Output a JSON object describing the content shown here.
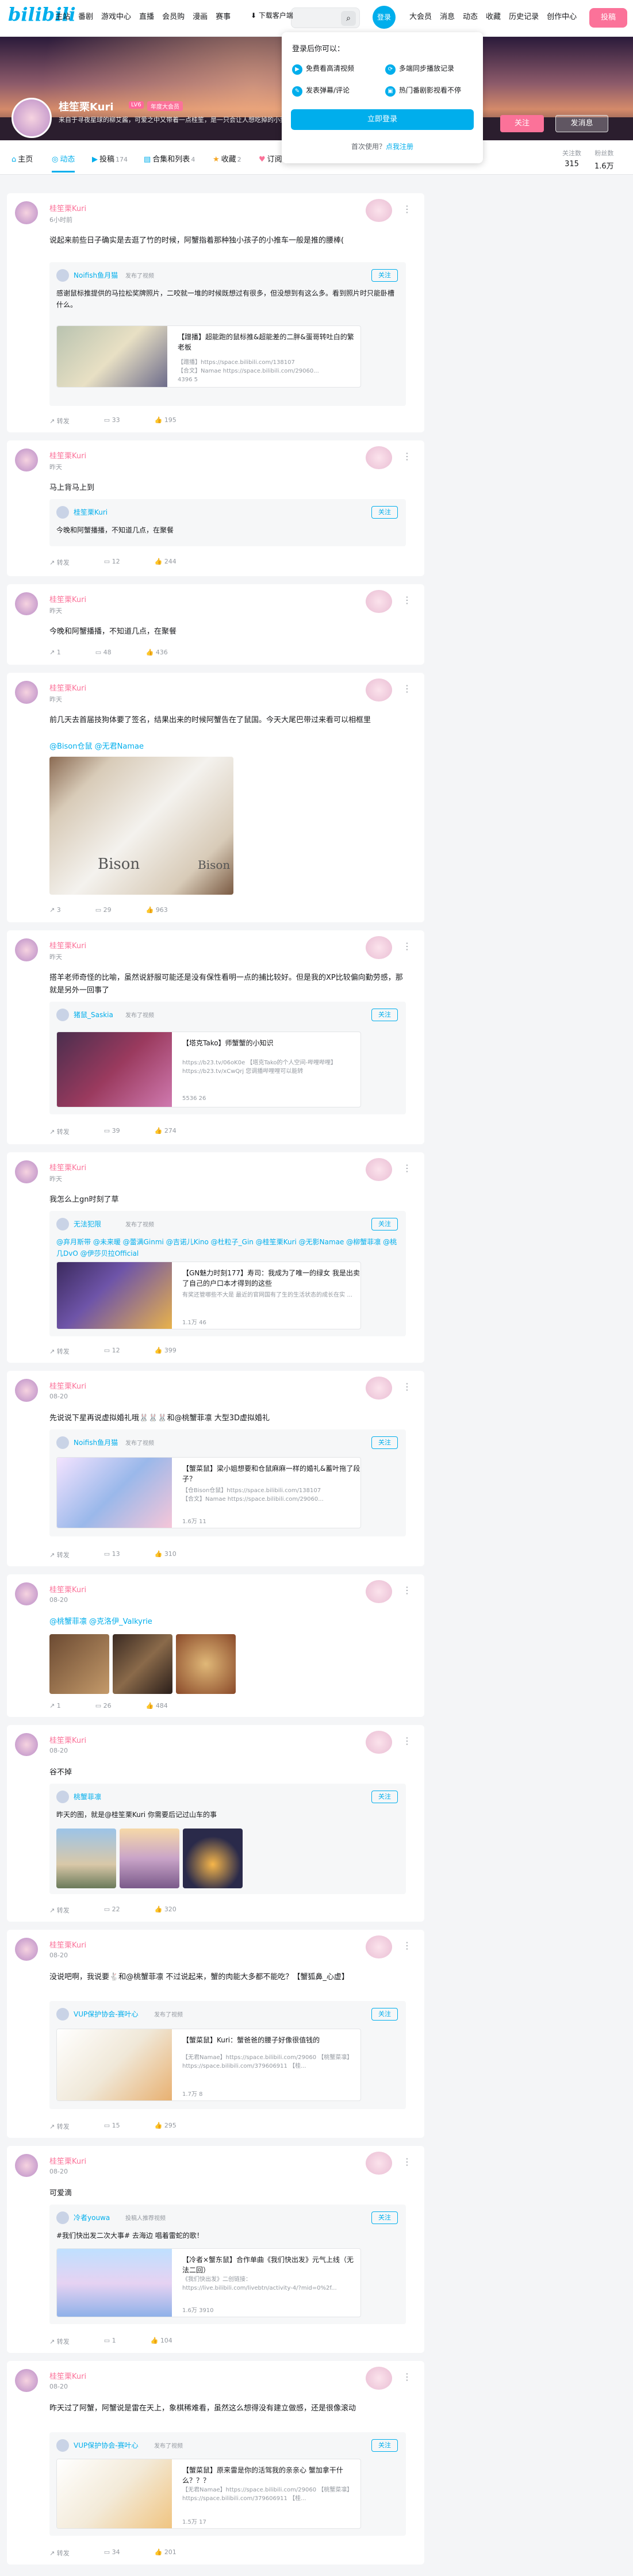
{
  "top": {
    "logo": "bilibili",
    "nav": [
      "主站",
      "番剧",
      "游戏中心",
      "直播",
      "会员购",
      "漫画",
      "赛事"
    ],
    "download": "下载客户端",
    "login_avatar": "登录",
    "nav_right": [
      "大会员",
      "消息",
      "动态",
      "收藏",
      "历史记录",
      "创作中心"
    ],
    "post": "投稿"
  },
  "popup": {
    "title": "登录后你可以：",
    "features": [
      "免费看高清视频",
      "多端同步播放记录",
      "发表弹幕/评论",
      "热门番剧影视看不停"
    ],
    "login": "立即登录",
    "first": "首次使用？",
    "register": "点我注册"
  },
  "user": {
    "name": "桂笙栗Kuri",
    "level": "LV6",
    "vip": "年度大会员",
    "sign": "来自于寻夜星球的柳艾酱，可爱之中又带着一点桂笙，是一只会让人想吃掉的小栗子~",
    "follow": "关注",
    "message": "发消息"
  },
  "tabs": [
    {
      "label": "主页",
      "count": ""
    },
    {
      "label": "动态",
      "count": ""
    },
    {
      "label": "投稿",
      "count": "174"
    },
    {
      "label": "合集和列表",
      "count": "4"
    },
    {
      "label": "收藏",
      "count": "2"
    },
    {
      "label": "订阅",
      "count": ""
    }
  ],
  "stats": [
    {
      "label": "关注数",
      "value": "315"
    },
    {
      "label": "粉丝数",
      "value": "1.6万"
    }
  ],
  "feed": [
    {
      "name": "桂笙栗Kuri",
      "time": "6小时前",
      "text": "说起来前些日子确实是去逛了竹的时候，阿蟹指着那种独小孩子的小推车一般是推的腰棒(",
      "fwd": {
        "name": "Noifish鱼月猫",
        "tag": "发布了视频",
        "text": "感谢鼠标推提供的马拉松奖牌照片，二咬就一堆的时候既想过有很多，但没想到有这么多。看到照片时只能卧槽什么。",
        "video": {
          "title": "【蹭播】超能跑的鼠标推&超能差的二胖&蛋哥转吐白的繁老板",
          "desc": "【蹭播】https://space.bilibili.com/138107\n【合文】Namae https://space.bilibili.com/29060...",
          "stats": "4396   5"
        }
      },
      "acts": [
        "转发",
        "33",
        "195"
      ]
    },
    {
      "name": "桂笙栗Kuri",
      "time": "昨天",
      "text": "马上背马上到",
      "fwd": {
        "name": "桂笙栗Kuri",
        "tag": "",
        "text": "今晚和阿蟹播播，不知道几点，在聚餐"
      },
      "acts": [
        "转发",
        "12",
        "244"
      ]
    },
    {
      "name": "桂笙栗Kuri",
      "time": "昨天",
      "text": "今晚和阿蟹播播，不知道几点，在聚餐",
      "acts": [
        "1",
        "48",
        "436"
      ]
    },
    {
      "name": "桂笙栗Kuri",
      "time": "昨天",
      "text": "前几天去首届技狗体要了签名，结果出来的时候阿蟹告在了鼠国。今天大尾巴带过来看可以相框里",
      "mention": "@Bison仓鼠 @无君Namae",
      "acts": [
        "3",
        "29",
        "963"
      ]
    },
    {
      "name": "桂笙栗Kuri",
      "time": "昨天",
      "text": "搭羊老师奇怪的比喻，虽然说舒服可能还是没有保性看明一点的捕比较好。但是我的XP比较偏向勤劳感，那就是另外一回事了",
      "fwd": {
        "name": "猪鼠_Saskia",
        "tag": "发布了视频",
        "video": {
          "title": "【塔克Tako】师蟹蟹的小知识",
          "desc": "https://b23.tv/06oK0e 【塔克Tako的个人空间-哔哩哔哩】 https://b23.tv/xCwQrj 您调播哔哩哩可以能转",
          "stats": "5536   26"
        }
      },
      "acts": [
        "转发",
        "39",
        "274"
      ]
    },
    {
      "name": "桂笙栗Kuri",
      "time": "昨天",
      "text": "我怎么上gn时刻了草",
      "fwd": {
        "name": "无法犯限",
        "tag": "发布了视频",
        "text": "@弃月斯带 @未来暖 @蕾满Ginmi @吉诺儿Kino @杜粒子_Gin @桂笙栗Kuri @无影Namae @柳蟹菲凛 @桃几DvO @伊莎贝拉Official",
        "video": {
          "title": "【GN魅力时刻177】寿司：我成为了唯一的绿女 我是出卖了自己的户口本才得到的这些",
          "desc": "有奖还管哪些不大是 最近的官网国有了生的生活状态的成长在实 ...",
          "stats": "1.1万   46"
        }
      },
      "acts": [
        "转发",
        "12",
        "399"
      ]
    },
    {
      "name": "桂笙栗Kuri",
      "time": "08-20",
      "text": "先说说下星再说虚拟婚礼哦🐰🐰🐰和@桃蟹菲凛 大型3D虚拟婚礼",
      "fwd": {
        "name": "Noifish鱼月猫",
        "tag": "发布了视频",
        "video": {
          "title": "【蟹菜鼠】梁小姐想要和仓鼠麻麻一样的婚礼&蓄叶拖了段子？",
          "desc": "【仓Bison仓鼠】https://space.bilibili.com/138107\n【合文】Namae https://space.bilibili.com/29060...",
          "stats": "1.6万   11"
        }
      },
      "acts": [
        "转发",
        "13",
        "310"
      ]
    },
    {
      "name": "桂笙栗Kuri",
      "time": "08-20",
      "text": "",
      "mention": "@桃蟹菲凛 @克洛伊_Valkyrie",
      "acts": [
        "1",
        "26",
        "484"
      ]
    },
    {
      "name": "桂笙栗Kuri",
      "time": "08-20",
      "text": "谷不掉",
      "fwd": {
        "name": "桃蟹菲凛",
        "tag": "",
        "text": "昨天的图，就是@桂笙栗Kuri 你需要后记过山车的事"
      },
      "acts": [
        "转发",
        "22",
        "320"
      ]
    },
    {
      "name": "桂笙栗Kuri",
      "time": "08-20",
      "text": "没说吧啊，我说要🐇和@桃蟹菲凛 不过说起来，蟹的肉能大多都不能吃？【蟹狐鼻_心虚】",
      "fwd": {
        "name": "VUP保护协会-赛叶心",
        "tag": "发布了视频",
        "video": {
          "title": "【蟹菜鼠】Kuri：蟹爸爸的腰子好像很值钱的",
          "desc": "【无君Namae】https://space.bilibili.com/29060 【桃蟹菜凛】https://space.bilibili.com/379606911 【桂...",
          "stats": "1.7万   8"
        }
      },
      "acts": [
        "转发",
        "15",
        "295"
      ]
    },
    {
      "name": "桂笙栗Kuri",
      "time": "08-20",
      "text": "可爱滴",
      "fwd": {
        "name": "冷者youwa",
        "tag": "投稿人推荐视频",
        "text": "#我们快出发二次大事# 去海边 唱着雷蛇的歌！",
        "video": {
          "title": "【冷者×蟹东鼠】合作单曲《我们快出发》元气上线（无法二回）",
          "desc": "《我们快出发》二创链接：https://live.bilibili.com/livebtn/activity-4/?mid=0%2f...",
          "stats": "1.6万   3910"
        }
      },
      "acts": [
        "转发",
        "1",
        "104"
      ]
    },
    {
      "name": "桂笙栗Kuri",
      "time": "08-20",
      "text": "昨天过了阿蟹，阿蟹说是雷在天上，象棋稀难看，虽然这么想得没有建立做感，还是很像滚动",
      "fwd": {
        "name": "VUP保护协会-赛叶心",
        "tag": "发布了视频",
        "video": {
          "title": "【蟹菜鼠】原来雷是你的活驾我的亲亲心 蟹加拿干什么？？？",
          "desc": "【无君Namae】https://space.bilibili.com/29060 【桃蟹菜凛】https://space.bilibili.com/379606911 【桂...",
          "stats": "1.5万   17"
        }
      },
      "acts": [
        "转发",
        "34",
        "201"
      ]
    }
  ],
  "colors": {
    "accent": "#00aeec",
    "pink": "#fb7299"
  }
}
